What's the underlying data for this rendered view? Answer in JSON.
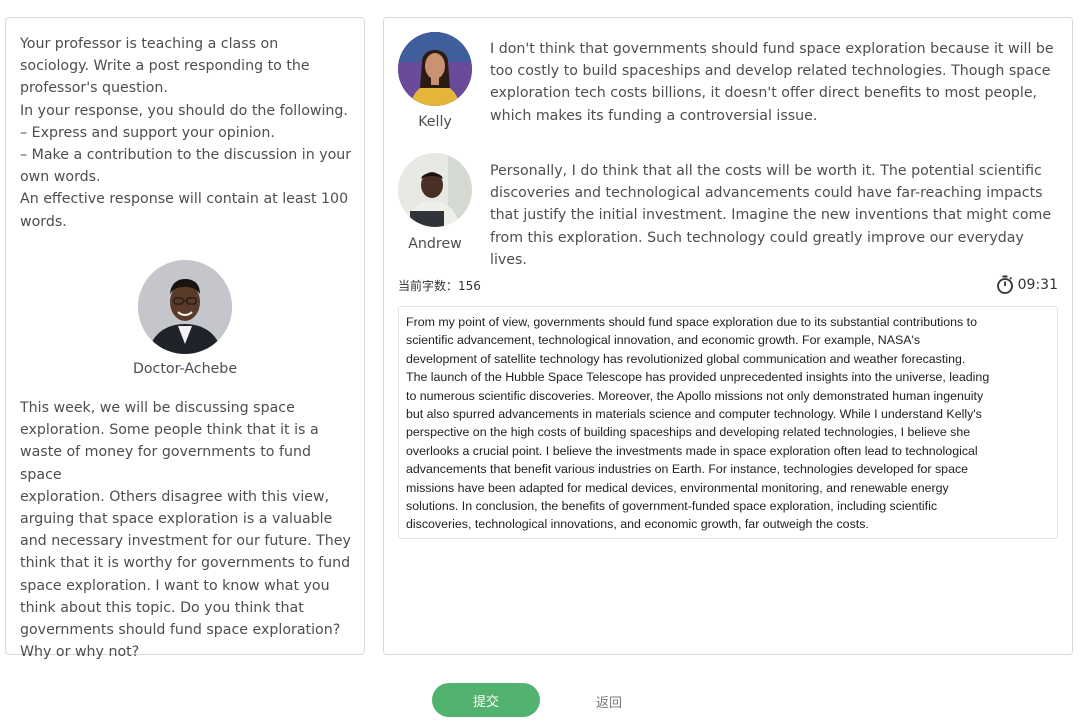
{
  "prompt": {
    "lines": [
      "Your professor is teaching a class on",
      "sociology. Write a post responding to the",
      "professor's question.",
      "In your response, you should do the following.",
      "– Express and support your opinion.",
      "– Make a contribution to the discussion in your",
      "own words.",
      "An effective response will contain at least 100",
      "words."
    ]
  },
  "professor": {
    "name": "Doctor-Achebe",
    "discussion_lines": [
      "This week, we will be discussing space",
      "exploration. Some people think that it is a",
      "waste of money for governments to fund space",
      "exploration. Others disagree with this view,",
      "arguing that space exploration is a valuable",
      "and necessary investment for our future. They",
      "think that it is worthy for governments to fund",
      "space exploration. I want to know what you",
      "think about this topic. Do you think that",
      "governments should fund space exploration?",
      "Why or why not?"
    ]
  },
  "students": [
    {
      "name": "Kelly",
      "post_lines": [
        "I don't think that governments should fund space exploration because it will be",
        "too costly to build spaceships and develop related technologies. Though space",
        "exploration tech costs billions, it doesn't offer direct benefits to most people,",
        "which makes its funding a controversial issue."
      ]
    },
    {
      "name": "Andrew",
      "post_lines": [
        "Personally, I do think that all the costs will be worth it. The potential scientific",
        "discoveries and technological advancements could have far-reaching impacts",
        "that justify the initial investment. Imagine the new inventions that might come",
        "from this exploration. Such technology could greatly improve our everyday lives."
      ]
    }
  ],
  "editor": {
    "word_count_label": "当前字数：",
    "word_count": "156",
    "timer": "09:31",
    "response_lines": [
      "From my point of view, governments should fund space exploration due to its substantial contributions to",
      "scientific advancement, technological innovation, and economic growth. For example, NASA's",
      "development of satellite technology has revolutionized global communication and weather forecasting.",
      "The launch of the Hubble Space Telescope has provided unprecedented insights into the universe, leading",
      "to numerous scientific discoveries. Moreover, the Apollo missions not only demonstrated human ingenuity",
      "but also spurred advancements in materials science and computer technology. While I understand Kelly's",
      "perspective on the high costs of building spaceships and developing related technologies, I believe she",
      "overlooks a crucial point. I believe the investments made in space exploration often lead to technological",
      "advancements that benefit various industries on Earth. For instance, technologies developed for space",
      "missions have been adapted for medical devices, environmental monitoring, and renewable energy",
      "solutions. In conclusion, the benefits of government-funded space exploration, including scientific",
      "discoveries, technological innovations, and economic growth, far outweigh the costs."
    ]
  },
  "actions": {
    "submit_label": "提交",
    "back_label": "返回"
  },
  "icons": {
    "timer": "stopwatch-icon"
  },
  "colors": {
    "submit_bg": "#52b36e",
    "border": "#d9d9d9"
  }
}
